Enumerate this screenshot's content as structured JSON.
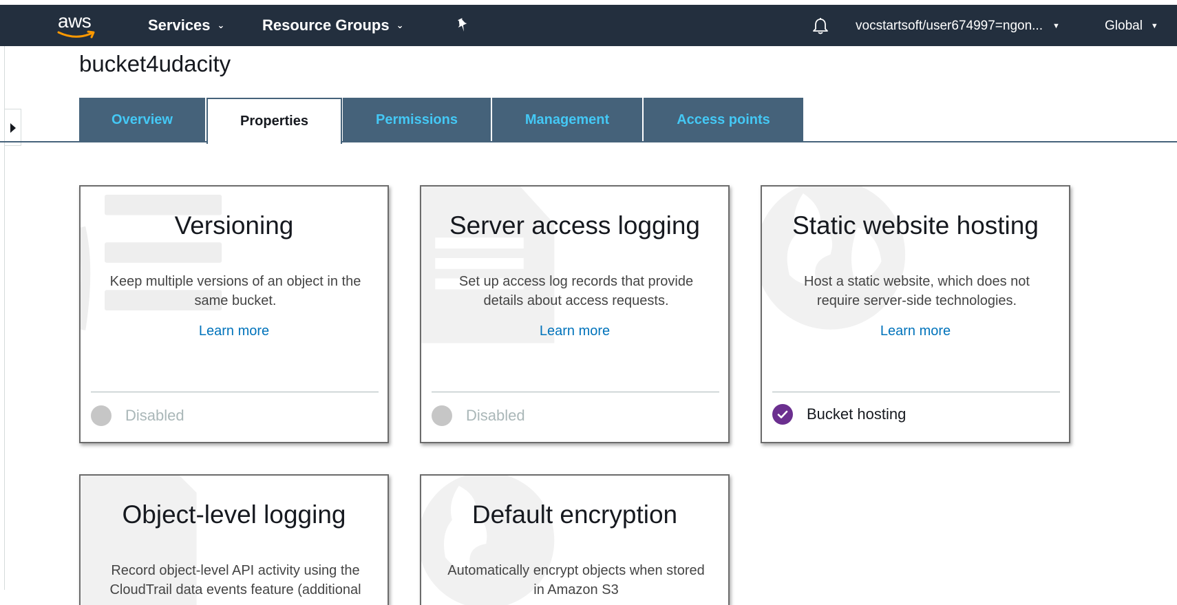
{
  "navbar": {
    "logo_text": "aws",
    "services_label": "Services",
    "resource_groups_label": "Resource Groups",
    "account_label": "vocstartsoft/user674997=ngon...",
    "region_label": "Global",
    "bg_color": "#232f3e"
  },
  "page": {
    "bucket_name": "bucket4udacity"
  },
  "tabs": [
    {
      "label": "Overview",
      "active": false
    },
    {
      "label": "Properties",
      "active": true
    },
    {
      "label": "Permissions",
      "active": false
    },
    {
      "label": "Management",
      "active": false
    },
    {
      "label": "Access points",
      "active": false
    }
  ],
  "cards": [
    {
      "title": "Versioning",
      "description": "Keep multiple versions of an object in the same bucket.",
      "link": "Learn more",
      "status": "Disabled",
      "enabled": false,
      "bg_icon": "versions-icon"
    },
    {
      "title": "Server access logging",
      "description": "Set up access log records that provide details about access requests.",
      "link": "Learn more",
      "status": "Disabled",
      "enabled": false,
      "bg_icon": "log-document-icon"
    },
    {
      "title": "Static website hosting",
      "description": "Host a static website, which does not require server-side technologies.",
      "link": "Learn more",
      "status": "Bucket hosting",
      "enabled": true,
      "bg_icon": "globe-icon"
    },
    {
      "title": "Object-level logging",
      "description": "Record object-level API activity using the CloudTrail data events feature (additional",
      "bg_icon": "log-document-icon"
    },
    {
      "title": "Default encryption",
      "description": "Automatically encrypt objects when stored in Amazon S3",
      "bg_icon": "globe-icon"
    }
  ],
  "colors": {
    "tab_bg": "#45627a",
    "tab_text": "#44c8f5",
    "link": "#0073bb",
    "enabled_dot": "#6b2f8f",
    "disabled_dot": "#c6c6c6"
  }
}
